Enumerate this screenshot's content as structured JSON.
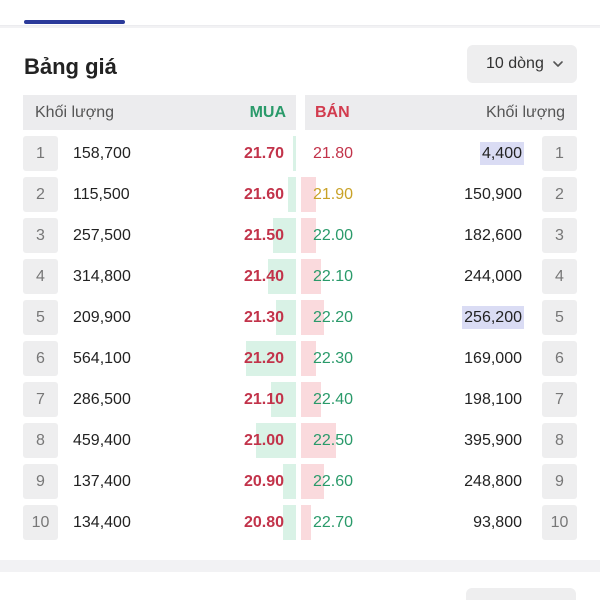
{
  "title": "Bảng giá",
  "rows_select": {
    "label": "10 dòng"
  },
  "header": {
    "buy_volume": "Khối lượng",
    "buy": "MUA",
    "sell": "BÁN",
    "sell_volume": "Khối lượng"
  },
  "colors": {
    "buy_text": "#2a9a6a",
    "sell_text": "#d23b4e",
    "price_up": "#2a9a6a",
    "price_down": "#c2334a",
    "reference": "#c9a227",
    "accent_tab": "#2b3a9a"
  },
  "order_book": [
    {
      "index": "1",
      "buy_volume": "158,700",
      "buy_price": "21.70",
      "sell_price": "21.80",
      "sell_price_color": "#c2334a",
      "sell_volume": "4,400",
      "sell_highlight": true,
      "buy_depth": 0.05,
      "sell_depth": 0.0
    },
    {
      "index": "2",
      "buy_volume": "115,500",
      "buy_price": "21.60",
      "sell_price": "21.90",
      "sell_price_color": "#c9a227",
      "sell_volume": "150,900",
      "sell_highlight": false,
      "buy_depth": 0.15,
      "sell_depth": 0.3
    },
    {
      "index": "3",
      "buy_volume": "257,500",
      "buy_price": "21.50",
      "sell_price": "22.00",
      "sell_price_color": "#2a9a6a",
      "sell_volume": "182,600",
      "sell_highlight": false,
      "buy_depth": 0.45,
      "sell_depth": 0.3
    },
    {
      "index": "4",
      "buy_volume": "314,800",
      "buy_price": "21.40",
      "sell_price": "22.10",
      "sell_price_color": "#2a9a6a",
      "sell_volume": "244,000",
      "sell_highlight": false,
      "buy_depth": 0.55,
      "sell_depth": 0.4
    },
    {
      "index": "5",
      "buy_volume": "209,900",
      "buy_price": "21.30",
      "sell_price": "22.20",
      "sell_price_color": "#2a9a6a",
      "sell_volume": "256,200",
      "sell_highlight": true,
      "buy_depth": 0.4,
      "sell_depth": 0.45
    },
    {
      "index": "6",
      "buy_volume": "564,100",
      "buy_price": "21.20",
      "sell_price": "22.30",
      "sell_price_color": "#2a9a6a",
      "sell_volume": "169,000",
      "sell_highlight": false,
      "buy_depth": 1.0,
      "sell_depth": 0.3
    },
    {
      "index": "7",
      "buy_volume": "286,500",
      "buy_price": "21.10",
      "sell_price": "22.40",
      "sell_price_color": "#2a9a6a",
      "sell_volume": "198,100",
      "sell_highlight": false,
      "buy_depth": 0.5,
      "sell_depth": 0.4
    },
    {
      "index": "8",
      "buy_volume": "459,400",
      "buy_price": "21.00",
      "sell_price": "22.50",
      "sell_price_color": "#2a9a6a",
      "sell_volume": "395,900",
      "sell_highlight": false,
      "buy_depth": 0.8,
      "sell_depth": 0.7
    },
    {
      "index": "9",
      "buy_volume": "137,400",
      "buy_price": "20.90",
      "sell_price": "22.60",
      "sell_price_color": "#2a9a6a",
      "sell_volume": "248,800",
      "sell_highlight": false,
      "buy_depth": 0.25,
      "sell_depth": 0.45
    },
    {
      "index": "10",
      "buy_volume": "134,400",
      "buy_price": "20.80",
      "sell_price": "22.70",
      "sell_price_color": "#2a9a6a",
      "sell_volume": "93,800",
      "sell_highlight": false,
      "buy_depth": 0.25,
      "sell_depth": 0.2
    }
  ]
}
